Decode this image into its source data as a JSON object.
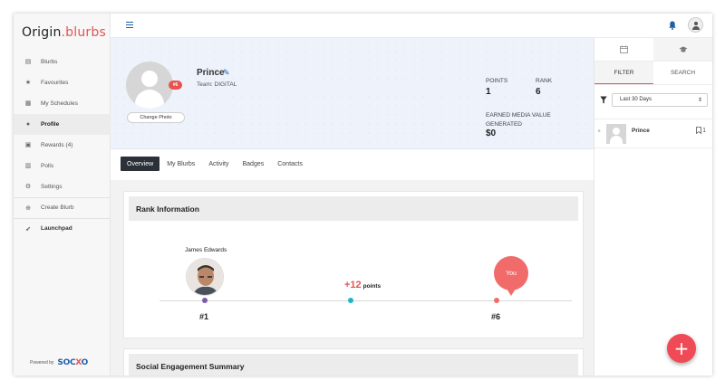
{
  "brand": {
    "logo_left": "Origin",
    "logo_right": "blurbs",
    "powered_by": "Powered by",
    "powered_brand_left": "SOC",
    "powered_brand_x": "X",
    "powered_brand_right": "O"
  },
  "sidebar": {
    "items": [
      {
        "label": "Blurbs",
        "icon": "document-icon"
      },
      {
        "label": "Favourites",
        "icon": "star-icon"
      },
      {
        "label": "My Schedules",
        "icon": "calendar-icon"
      },
      {
        "label": "Profile",
        "icon": "user-icon",
        "active": true
      },
      {
        "label": "Rewards (4)",
        "icon": "gift-icon"
      },
      {
        "label": "Polls",
        "icon": "bar-chart-icon"
      },
      {
        "label": "Settings",
        "icon": "gear-icon"
      },
      {
        "label": "Create Blurb",
        "icon": "plus-circle-icon"
      },
      {
        "label": "Launchpad",
        "icon": "rocket-icon"
      }
    ]
  },
  "profile": {
    "name": "Prince",
    "team": "Team: DIGITAL",
    "badge": "#6",
    "change_photo": "Change Photo",
    "points_label": "POINTS",
    "points": "1",
    "rank_label": "RANK",
    "rank": "6",
    "emv_label_1": "EARNED MEDIA VALUE",
    "emv_label_2": "GENERATED",
    "emv": "$0"
  },
  "tabs": [
    "Overview",
    "My Blurbs",
    "Activity",
    "Badges",
    "Contacts"
  ],
  "rank_info": {
    "title": "Rank Information",
    "leader_name": "James Edwards",
    "leader_rank": "#1",
    "points_diff": "+12",
    "points_word": "points",
    "you_label": "You",
    "you_rank": "#6",
    "colors": {
      "leader_dot": "#7a5ca8",
      "mid_dot": "#1fb4c9",
      "you_dot": "#f26b6b"
    }
  },
  "social": {
    "title": "Social Engagement Summary"
  },
  "right_panel": {
    "filter_tab": "FILTER",
    "search_tab": "SEARCH",
    "period": "Last 30 Days",
    "leader_item": {
      "rank": "6",
      "name": "Prince",
      "count": "1"
    }
  },
  "colors": {
    "accent": "#e8534f",
    "brand_blue": "#1f5fa8",
    "fab": "#ef4a55"
  }
}
